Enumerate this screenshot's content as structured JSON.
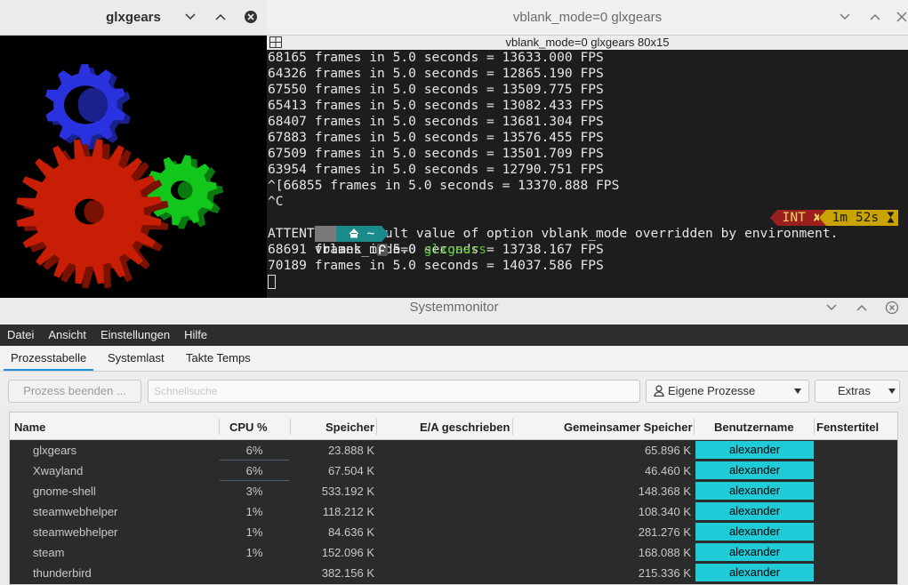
{
  "glxgears": {
    "title": "glxgears",
    "gear_colors": {
      "red": "#c81e06",
      "green": "#13c61c",
      "blue": "#2a32e0"
    }
  },
  "terminal": {
    "title": "vblank_mode=0 glxgears",
    "subtitle": "vblank_mode=0 glxgears 80x15",
    "lines_before": [
      "68165 frames in 5.0 seconds = 13633.000 FPS",
      "64326 frames in 5.0 seconds = 12865.190 FPS",
      "67550 frames in 5.0 seconds = 13509.775 FPS",
      "65413 frames in 5.0 seconds = 13082.433 FPS",
      "68407 frames in 5.0 seconds = 13681.304 FPS",
      "67883 frames in 5.0 seconds = 13576.455 FPS",
      "67509 frames in 5.0 seconds = 13501.709 FPS",
      "63954 frames in 5.0 seconds = 12790.751 FPS",
      "^[66855 frames in 5.0 seconds = 13370.888 FPS",
      "^C"
    ],
    "prompt": {
      "home_symbol": "~",
      "command_prefix": "vblank_mode=0 ",
      "command": "glxgears",
      "status": "INT ✘",
      "duration": "1m 52s"
    },
    "lines_after": [
      "ATTENTION: default value of option vblank_mode overridden by environment.",
      "68691 frames in 5.0 seconds = 13738.167 FPS",
      "70189 frames in 5.0 seconds = 14037.586 FPS"
    ]
  },
  "sysmon": {
    "title": "Systemmonitor",
    "menu": [
      "Datei",
      "Ansicht",
      "Einstellungen",
      "Hilfe"
    ],
    "tabs": [
      "Prozesstabelle",
      "Systemlast",
      "Takte Temps"
    ],
    "toolbar": {
      "end_process": "Prozess beenden ...",
      "search_placeholder": "Schnellsuche",
      "filter": "Eigene Prozesse",
      "extras": "Extras"
    },
    "columns": [
      "Name",
      "CPU %",
      "Speicher",
      "E/A geschrieben",
      "Gemeinsamer Speicher",
      "Benutzername",
      "Fenstertitel"
    ],
    "rows": [
      {
        "name": "glxgears",
        "cpu": "6%",
        "mem": "23.888 K",
        "shared": "65.896 K",
        "user": "alexander",
        "cpu_bar": true
      },
      {
        "name": "Xwayland",
        "cpu": "6%",
        "mem": "67.504 K",
        "shared": "46.460 K",
        "user": "alexander",
        "cpu_bar": true
      },
      {
        "name": "gnome-shell",
        "cpu": "3%",
        "mem": "533.192 K",
        "shared": "148.368 K",
        "user": "alexander",
        "cpu_bar": false
      },
      {
        "name": "steamwebhelper",
        "cpu": "1%",
        "mem": "118.212 K",
        "shared": "108.340 K",
        "user": "alexander",
        "cpu_bar": false
      },
      {
        "name": "steamwebhelper",
        "cpu": "1%",
        "mem": "84.636 K",
        "shared": "281.276 K",
        "user": "alexander",
        "cpu_bar": false
      },
      {
        "name": "steam",
        "cpu": "1%",
        "mem": "152.096 K",
        "shared": "168.088 K",
        "user": "alexander",
        "cpu_bar": false
      },
      {
        "name": "thunderbird",
        "cpu": "",
        "mem": "382.156 K",
        "shared": "215.336 K",
        "user": "alexander",
        "cpu_bar": false
      }
    ],
    "user_highlight_color": "#1ecbd6"
  }
}
